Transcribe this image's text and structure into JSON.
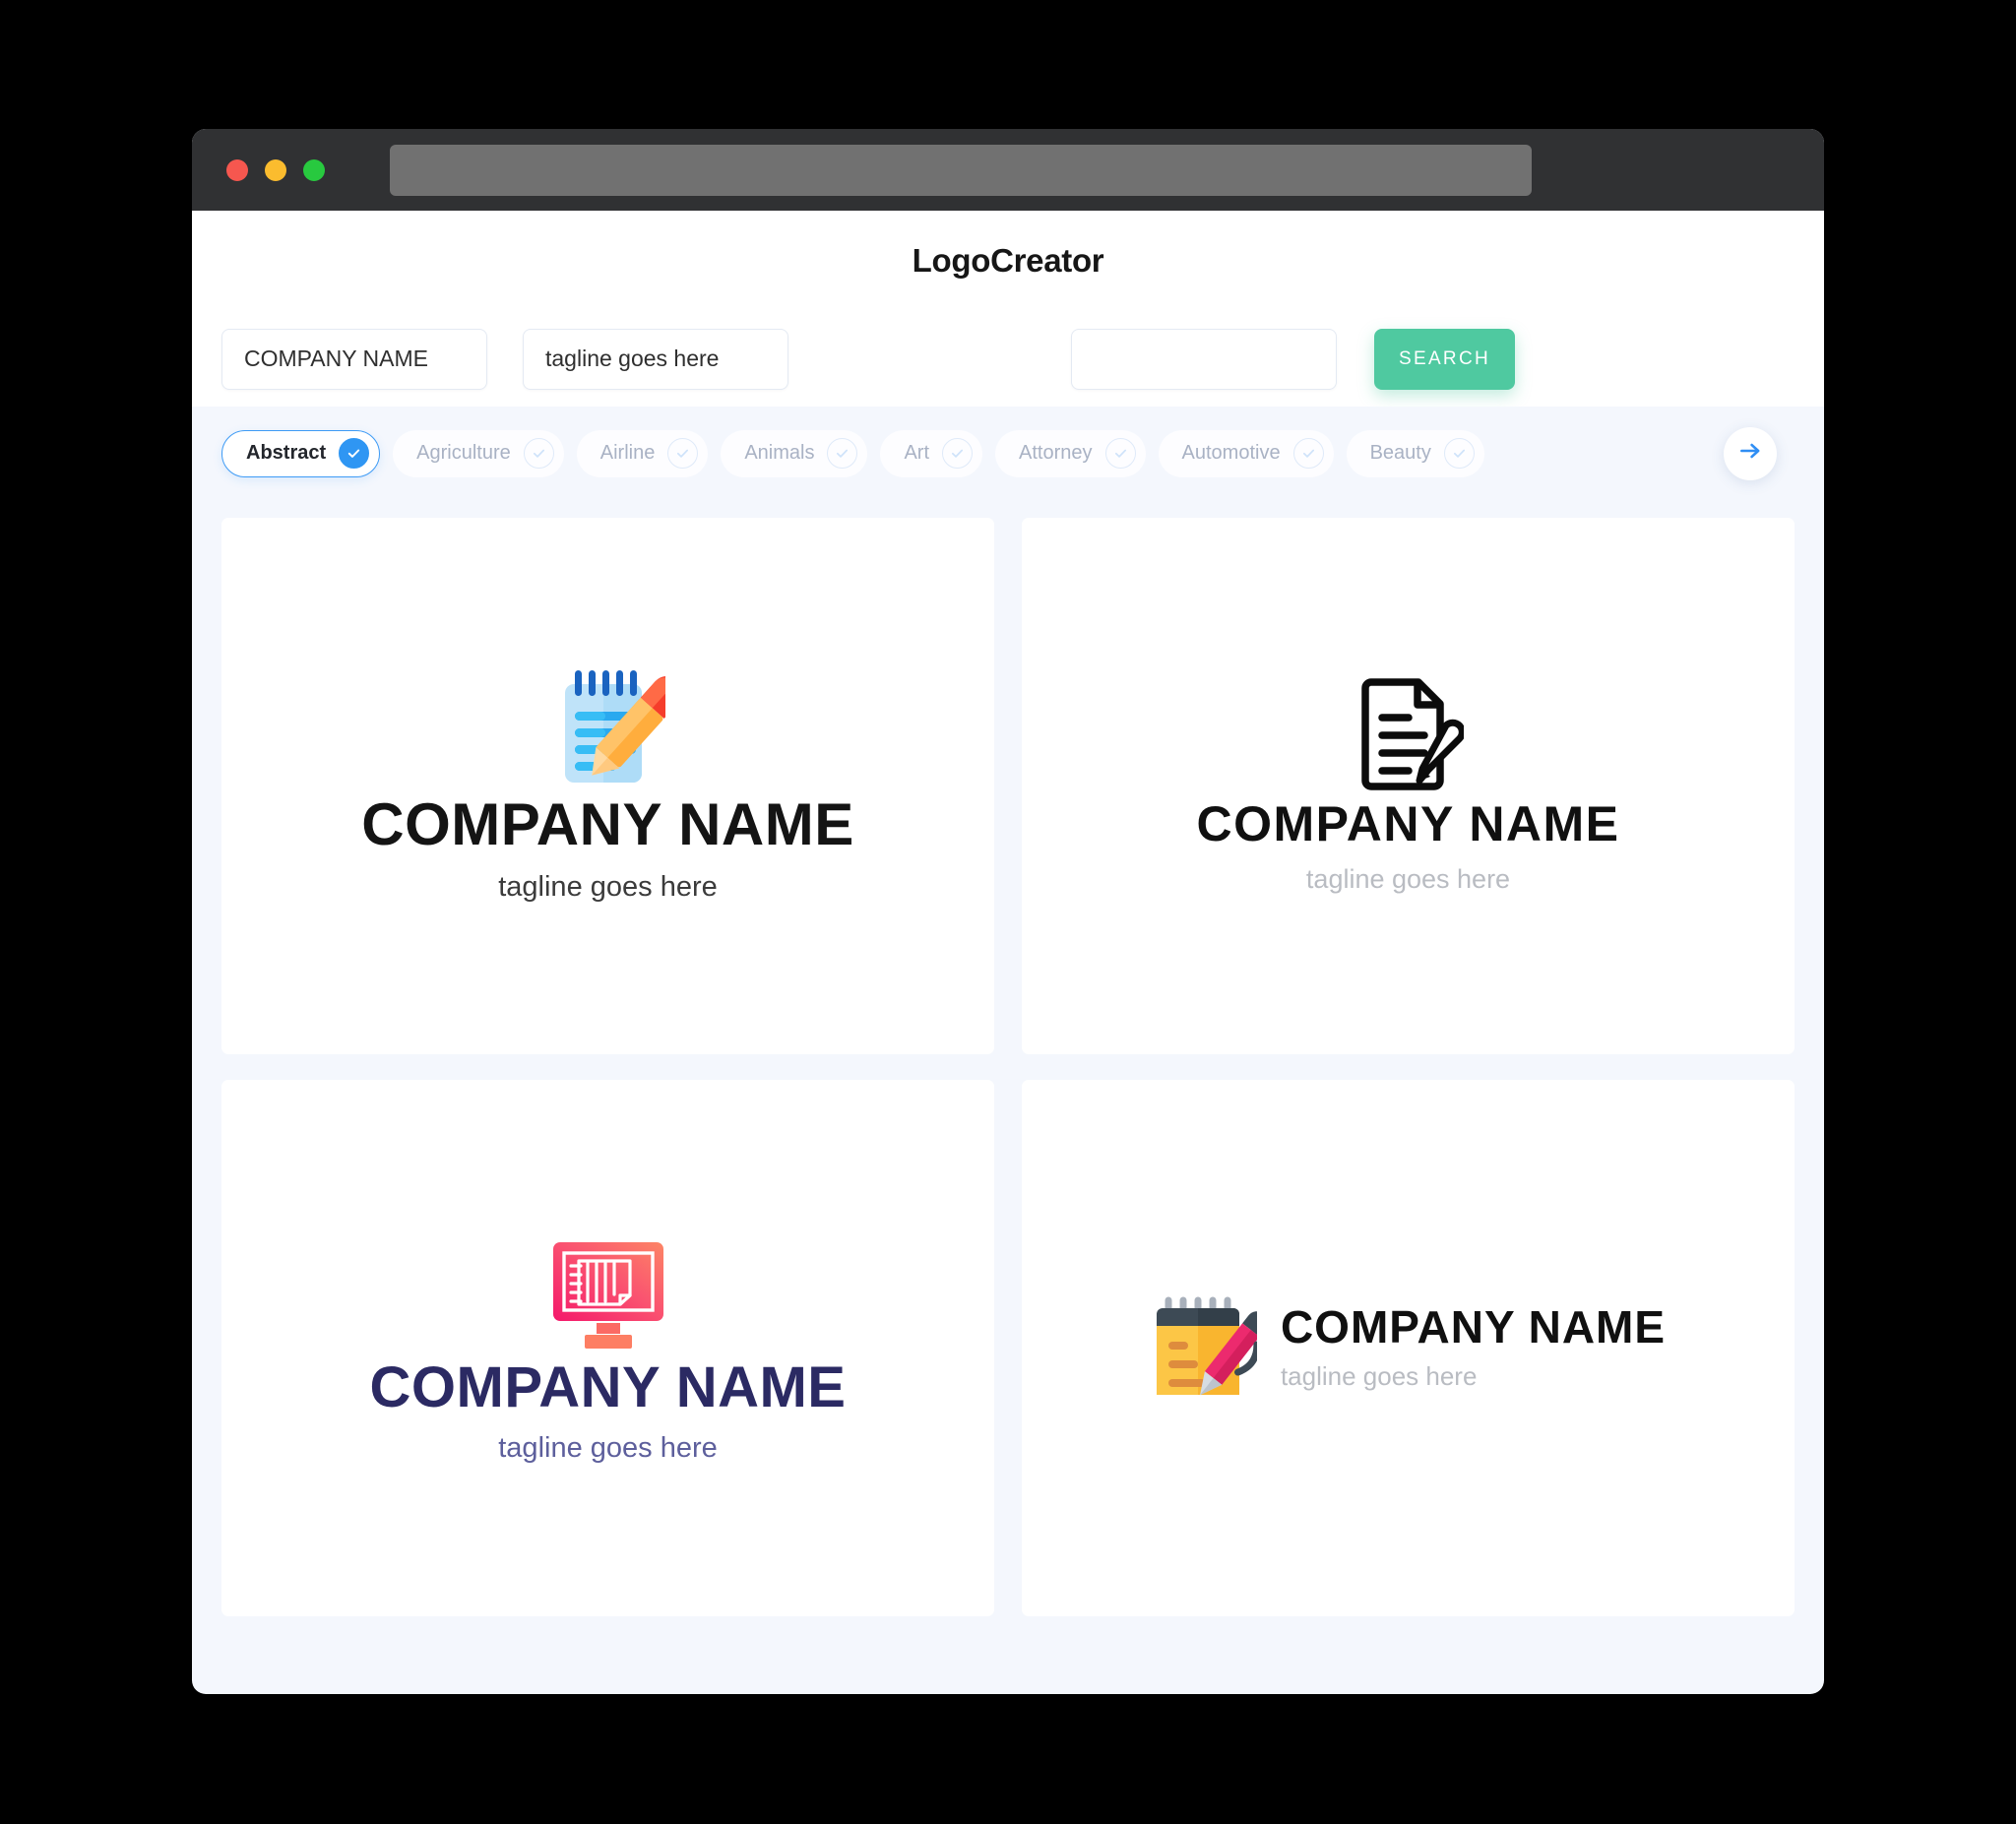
{
  "window": {
    "traffic_lights": [
      "close",
      "minimize",
      "zoom"
    ],
    "url_value": ""
  },
  "header": {
    "brand": "LogoCreator"
  },
  "search": {
    "company_value": "COMPANY NAME",
    "company_placeholder": "COMPANY NAME",
    "tagline_value": "tagline goes here",
    "tagline_placeholder": "tagline goes here",
    "extra_value": "",
    "extra_placeholder": "",
    "search_label": "SEARCH",
    "accent_color": "#4fc9a0"
  },
  "categories": {
    "active_color": "#2f96f3",
    "next_icon": "arrow-right-icon",
    "items": [
      {
        "label": "Abstract",
        "selected": true
      },
      {
        "label": "Agriculture",
        "selected": false
      },
      {
        "label": "Airline",
        "selected": false
      },
      {
        "label": "Animals",
        "selected": false
      },
      {
        "label": "Art",
        "selected": false
      },
      {
        "label": "Attorney",
        "selected": false
      },
      {
        "label": "Automotive",
        "selected": false
      },
      {
        "label": "Beauty",
        "selected": false
      }
    ]
  },
  "results": {
    "cards": [
      {
        "icon": "notepad-pencil-icon",
        "name": "COMPANY NAME",
        "tagline": "tagline goes here",
        "name_color": "#141414",
        "tagline_color": "#3b3b3b"
      },
      {
        "icon": "document-pen-outline-icon",
        "name": "COMPANY NAME",
        "tagline": "tagline goes here",
        "name_color": "#101010",
        "tagline_color": "#b9bcc2"
      },
      {
        "icon": "monitor-notepad-icon",
        "name": "COMPANY NAME",
        "tagline": "tagline goes here",
        "name_color": "#2b2a63",
        "tagline_color": "#5d5f9c"
      },
      {
        "icon": "yellow-notepad-pen-icon",
        "name": "COMPANY NAME",
        "tagline": "tagline goes here",
        "name_color": "#101010",
        "tagline_color": "#b9bcc2"
      }
    ]
  }
}
